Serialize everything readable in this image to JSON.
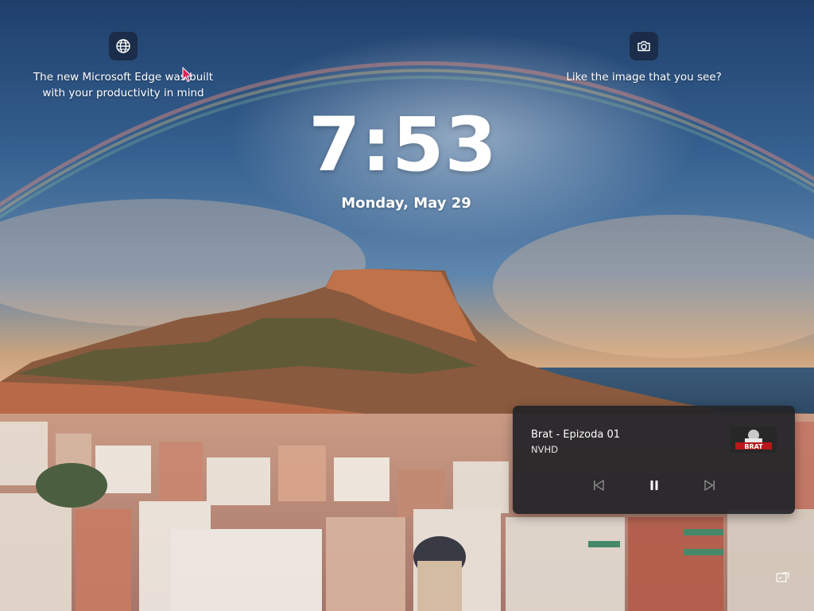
{
  "spotlight": {
    "left_tile": {
      "icon": "globe-icon",
      "line1": "The new Microsoft Edge was built",
      "line2": "with your productivity in mind"
    },
    "right_tile": {
      "icon": "camera-icon",
      "text": "Like the image that you see?"
    }
  },
  "clock": {
    "time": "7:53",
    "date": "Monday, May 29"
  },
  "media": {
    "title": "Brat - Epizoda 01",
    "artist": "NVHD",
    "thumbnail_text": "BRAT",
    "controls": {
      "previous_icon": "previous-track-icon",
      "play_pause_icon": "pause-icon",
      "next_icon": "next-track-icon"
    }
  },
  "colors": {
    "media_card_bg": "#242428",
    "tile_icon_bg": "#1a2842",
    "text": "#ffffff"
  }
}
